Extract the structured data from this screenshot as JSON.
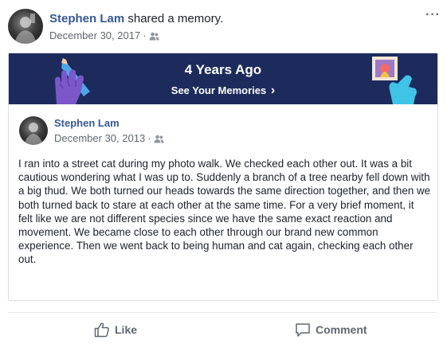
{
  "header": {
    "author": "Stephen Lam",
    "action_text": "shared a memory.",
    "date": "December 30, 2017",
    "separator": "·",
    "audience_icon": "friends-icon",
    "more_label": "···"
  },
  "memory_banner": {
    "title": "4 Years Ago",
    "link_label": "See Your Memories",
    "link_chevron": "›",
    "background_color": "#1c2b5c"
  },
  "original_post": {
    "author": "Stephen Lam",
    "date": "December 30, 2013",
    "separator": "·",
    "audience_icon": "friends-icon",
    "text": "I ran into a street cat during my photo walk. We checked each other out. It was a bit cautious wondering what I was up to. Suddenly a branch of a tree nearby fell down with a big thud. We both turned our heads towards the same direction together, and then we both turned back to stare at each other at the same time. For a very brief moment, it felt like we are not different species since we have the same exact reaction and movement. We became close to each other through our brand new common experience. Then we went back to being human and cat again, checking each other out."
  },
  "actions": {
    "like_label": "Like",
    "like_icon": "thumbs-up-icon",
    "comment_label": "Comment",
    "comment_icon": "speech-bubble-icon"
  },
  "colors": {
    "link_blue": "#365899",
    "muted_gray": "#616770",
    "banner_navy": "#1c2b5c"
  }
}
